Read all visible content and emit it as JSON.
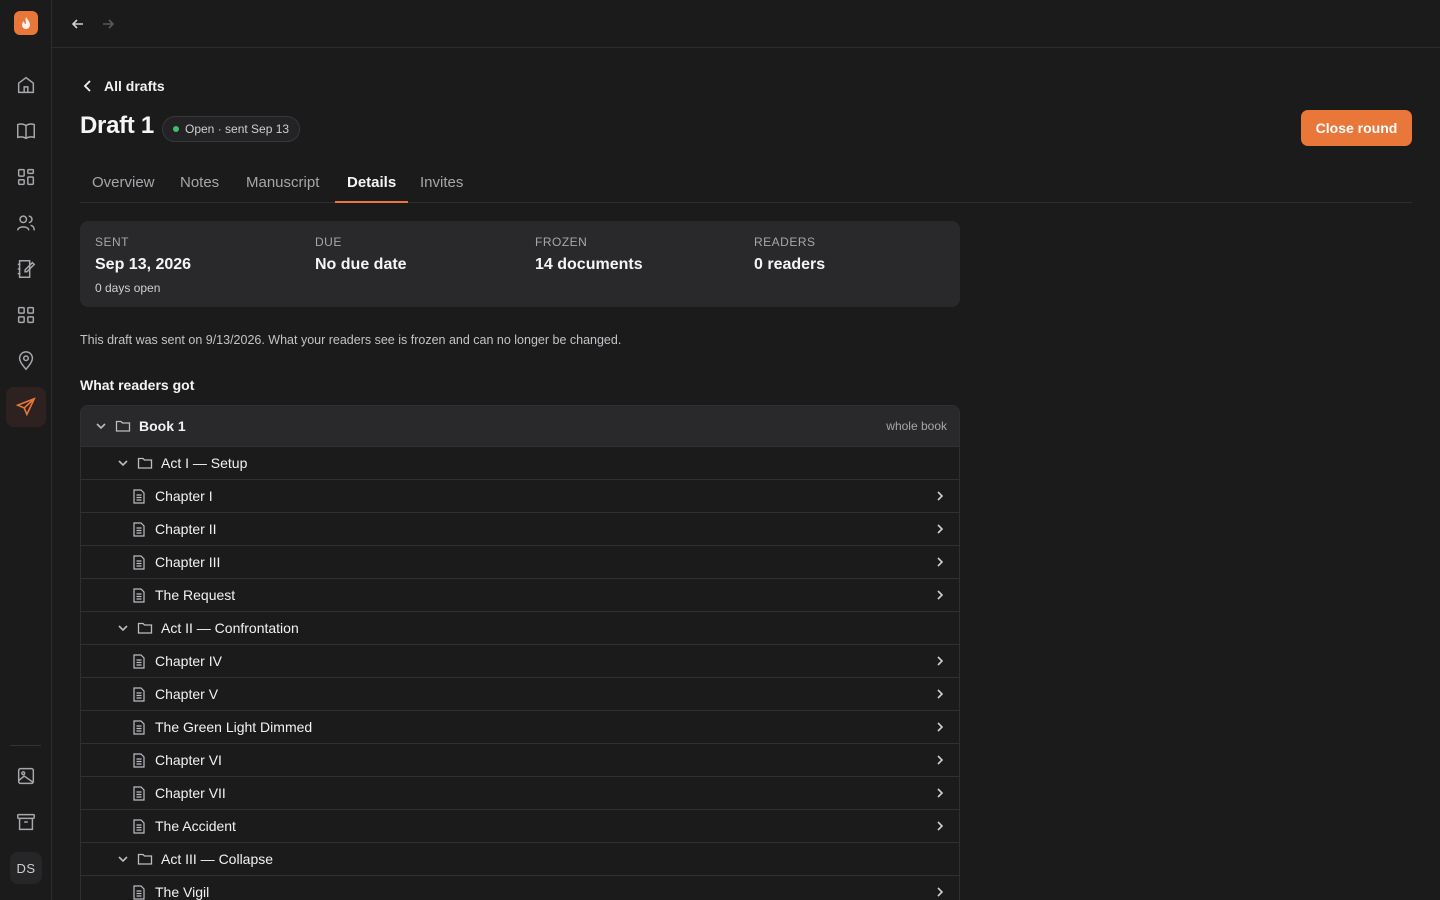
{
  "nav": {
    "back_label": "All drafts"
  },
  "header": {
    "title": "Draft 1",
    "status": "Open · sent Sep 13",
    "close_button": "Close round"
  },
  "tabs": [
    {
      "label": "Overview"
    },
    {
      "label": "Notes"
    },
    {
      "label": "Manuscript"
    },
    {
      "label": "Details",
      "active": true
    },
    {
      "label": "Invites"
    }
  ],
  "stats": [
    {
      "label": "SENT",
      "value": "Sep 13, 2026",
      "sub": "0 days open"
    },
    {
      "label": "DUE",
      "value": "No due date"
    },
    {
      "label": "FROZEN",
      "value": "14 documents"
    },
    {
      "label": "READERS",
      "value": "0 readers"
    }
  ],
  "notice": "This draft was sent on 9/13/2026. What your readers see is frozen and can no longer be changed.",
  "section_title": "What readers got",
  "tree": {
    "book": {
      "name": "Book 1",
      "scope": "whole book"
    },
    "acts": [
      {
        "name": "Act I — Setup",
        "chapters": [
          "Chapter I",
          "Chapter II",
          "Chapter III",
          "The Request"
        ]
      },
      {
        "name": "Act II — Confrontation",
        "chapters": [
          "Chapter IV",
          "Chapter V",
          "The Green Light Dimmed",
          "Chapter VI",
          "Chapter VII",
          "The Accident"
        ]
      },
      {
        "name": "Act III — Collapse",
        "chapters": [
          "The Vigil"
        ]
      }
    ]
  },
  "sidebar": {
    "avatar_initials": "DS",
    "items": [
      {
        "icon": "home-icon"
      },
      {
        "icon": "book-icon"
      },
      {
        "icon": "grid-icon"
      },
      {
        "icon": "users-icon"
      },
      {
        "icon": "notebook-icon"
      },
      {
        "icon": "apps-icon"
      },
      {
        "icon": "map-pin-icon"
      },
      {
        "icon": "send-icon",
        "active": true
      },
      {
        "icon": "image-icon"
      },
      {
        "icon": "archive-icon"
      }
    ]
  },
  "colors": {
    "accent": "#e9773a",
    "status_dot": "#3fbf6a",
    "background": "#1b1b1c",
    "panel": "#29292b"
  }
}
